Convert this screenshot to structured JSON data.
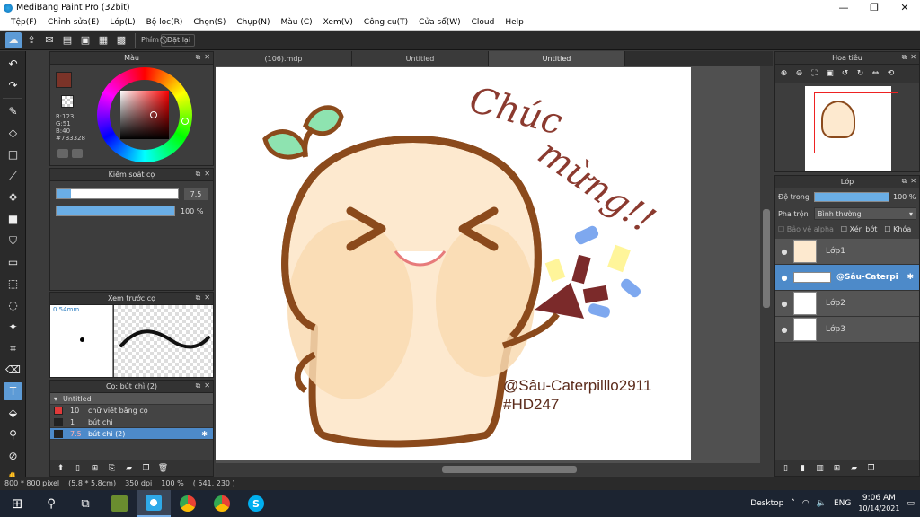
{
  "window": {
    "title": "MediBang Paint Pro (32bit)",
    "minimize": "—",
    "maximize": "❐",
    "close": "✕"
  },
  "menu": [
    "Tệp(F)",
    "Chỉnh sửa(E)",
    "Lớp(L)",
    "Bộ lọc(R)",
    "Chọn(S)",
    "Chụp(N)",
    "Màu (C)",
    "Xem(V)",
    "Công cụ(T)",
    "Cửa sổ(W)",
    "Cloud",
    "Help"
  ],
  "toolbar": {
    "shortcut_label": "Phím",
    "undo_label": "Đặt lại"
  },
  "color_panel": {
    "title": "Màu",
    "r": "R:123",
    "g": "G:51",
    "b": "B:40",
    "hex": "#7B3328",
    "main_color": "#7b3328"
  },
  "brush_control": {
    "title": "Kiểm soát cọ",
    "size_value": "7.5",
    "opacity_value": "100 %",
    "size_fraction": 0.12,
    "opacity_fraction": 1.0
  },
  "brush_preview": {
    "title": "Xem trước cọ",
    "size_label": "0.54mm"
  },
  "brush_list": {
    "title": "Cọ: bút chì (2)",
    "group": "Untitled",
    "items": [
      {
        "size": "10",
        "name": "chữ viết bằng cọ",
        "color": "#e03a3a"
      },
      {
        "size": "1",
        "name": "bút chì",
        "color": "#222222"
      },
      {
        "size": "7.5",
        "name": "bút chì (2)",
        "color": "#222222"
      }
    ]
  },
  "tabs": [
    "(106).mdp",
    "Untitled",
    "Untitled"
  ],
  "artwork": {
    "text_title_1": "Chúc",
    "text_title_2": "mừng!!",
    "signature": "@Sâu-Caterpilllo2911",
    "hashtag": "#HD247"
  },
  "navigator": {
    "title": "Hoa tiêu"
  },
  "layer_panel": {
    "title": "Lớp",
    "opacity_label": "Độ trong",
    "opacity_value": "100 %",
    "opacity_fraction": 1.0,
    "blend_label": "Pha trộn",
    "blend_value": "Bình thường",
    "protect_alpha": "Bảo vệ alpha",
    "clipping": "Xén bớt",
    "lock": "Khóa",
    "layers": [
      {
        "name": "Lớp1",
        "selected": false
      },
      {
        "name": "@Sâu-Caterpi",
        "selected": true
      },
      {
        "name": "Lớp2",
        "selected": false
      },
      {
        "name": "Lớp3",
        "selected": false
      }
    ]
  },
  "status": {
    "size": "800 * 800 pixel",
    "physical": "(5.8 * 5.8cm)",
    "dpi": "350 dpi",
    "zoom": "100 %",
    "coords": "( 541, 230 )"
  },
  "taskbar": {
    "desktop_label": "Desktop",
    "language": "ENG",
    "time": "9:06 AM",
    "date": "10/14/2021"
  }
}
